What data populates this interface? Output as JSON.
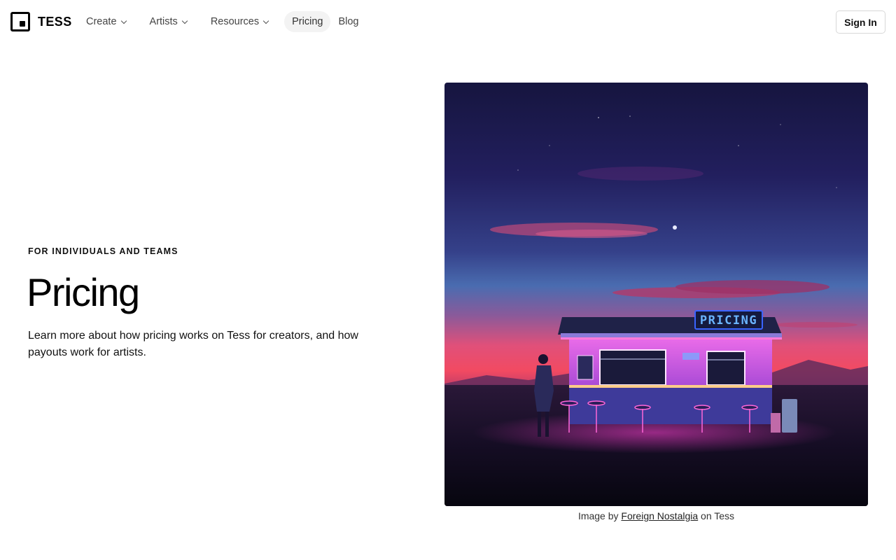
{
  "brand": {
    "name": "TESS"
  },
  "nav": {
    "items": [
      {
        "label": "Create",
        "dropdown": true
      },
      {
        "label": "Artists",
        "dropdown": true
      },
      {
        "label": "Resources",
        "dropdown": true
      },
      {
        "label": "Pricing",
        "dropdown": false,
        "active": true
      },
      {
        "label": "Blog",
        "dropdown": false
      }
    ],
    "signin_label": "Sign In"
  },
  "hero": {
    "eyebrow": "FOR INDIVIDUALS AND TEAMS",
    "title": "Pricing",
    "description": "Learn more about how pricing works on Tess for creators, and how payouts work for artists.",
    "image": {
      "sign_text": "PRICING",
      "caption_prefix": "Image by",
      "caption_artist": "Foreign Nostalgia",
      "caption_suffix": "on Tess"
    }
  },
  "colors": {
    "sky_top": "#16153f",
    "sky_mid": "#3a4c98",
    "sky_horizon": "#f04a6a",
    "neon_pink": "#ff4fd8",
    "neon_blue": "#5aa8ff"
  },
  "icons": [
    "tess-logo-icon",
    "chevron-down-icon"
  ]
}
